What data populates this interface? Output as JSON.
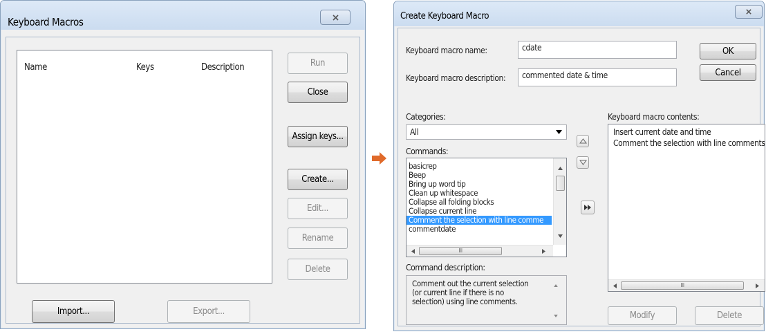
{
  "left_dialog": {
    "title": "Keyboard Macros",
    "table": {
      "columns": [
        "Name",
        "Keys",
        "Description"
      ],
      "rows": []
    },
    "buttons": {
      "run": "Run",
      "close": "Close",
      "assign_keys": "Assign keys...",
      "create": "Create...",
      "edit": "Edit...",
      "rename": "Rename",
      "delete": "Delete",
      "import": "Import...",
      "export": "Export..."
    }
  },
  "arrow_icon": "right-arrow-icon",
  "right_dialog": {
    "title": "Create Keyboard Macro",
    "name_label": "Keyboard macro name:",
    "name_value": "cdate",
    "description_label": "Keyboard macro description:",
    "description_value": "commented date & time",
    "ok_label": "OK",
    "cancel_label": "Cancel",
    "categories_label": "Categories:",
    "category_selected": "All",
    "commands_label": "Commands:",
    "commands": [
      "basicrep",
      "Beep",
      "Bring up word tip",
      "Clean up whitespace",
      "Collapse all folding blocks",
      "Collapse current line",
      "Comment the selection with line comme",
      "commentdate"
    ],
    "selected_command_index": 6,
    "hscroll_glyph": "III",
    "command_description_label": "Command description:",
    "command_description": "Comment out the current selection (or current line if there is no selection) using line comments.",
    "contents_label": "Keyboard macro contents:",
    "contents": [
      "Insert current date and time",
      "Comment the selection with line comments"
    ],
    "modify_label": "Modify",
    "delete_label": "Delete"
  },
  "colors": {
    "selection": "#3399ff",
    "arrow": "#e06a2a",
    "title_gradient_top": "#dde9f7",
    "disabled_text": "#8a8a8a"
  }
}
